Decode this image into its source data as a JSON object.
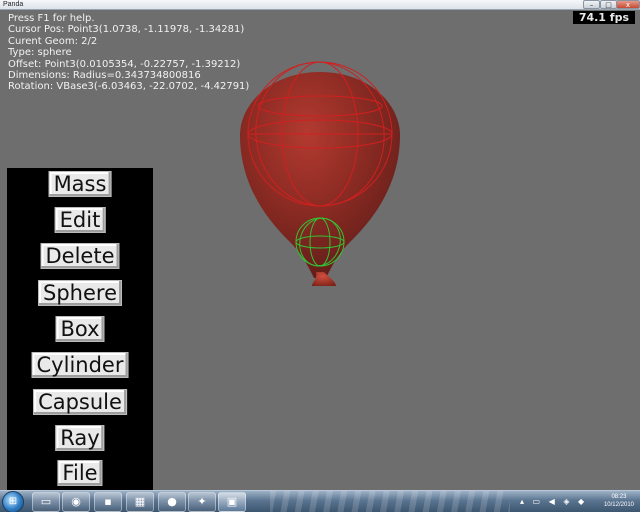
{
  "window": {
    "title": "Panda",
    "minimize_label": "–",
    "maximize_label": "□",
    "close_label": "x"
  },
  "hud": {
    "help_text": "Press F1 for help.",
    "cursor_pos": "Cursor Pos: Point3(1.0738, -1.11978, -1.34281)",
    "current_geom": "Curent Geom: 2/2",
    "type": "Type: sphere",
    "offset": "Offset: Point3(0.0105354, -0.22757, -1.39212)",
    "dimensions": "Dimensions: Radius=0.343734800816",
    "rotation": "Rotation: VBase3(-6.03463, -22.0702, -4.42791)",
    "fps": "74.1 fps"
  },
  "menu": {
    "mass": "Mass",
    "edit": "Edit",
    "delete": "Delete",
    "sphere": "Sphere",
    "box": "Box",
    "cylinder": "Cylinder",
    "capsule": "Capsule",
    "ray": "Ray",
    "file": "File"
  },
  "colors": {
    "balloon": "#8c2a22",
    "wireframe_red": "#d02020",
    "wireframe_green": "#30c030",
    "panel": "#000000"
  },
  "taskbar": {
    "start_icon": "windows-orb-icon",
    "apps": [
      "folder-icon",
      "firefox-icon",
      "terminal-icon",
      "calculator-icon",
      "media-icon",
      "game-icon",
      "panda-icon"
    ],
    "clock_time": "08:23",
    "clock_date": "10/12/2010"
  }
}
